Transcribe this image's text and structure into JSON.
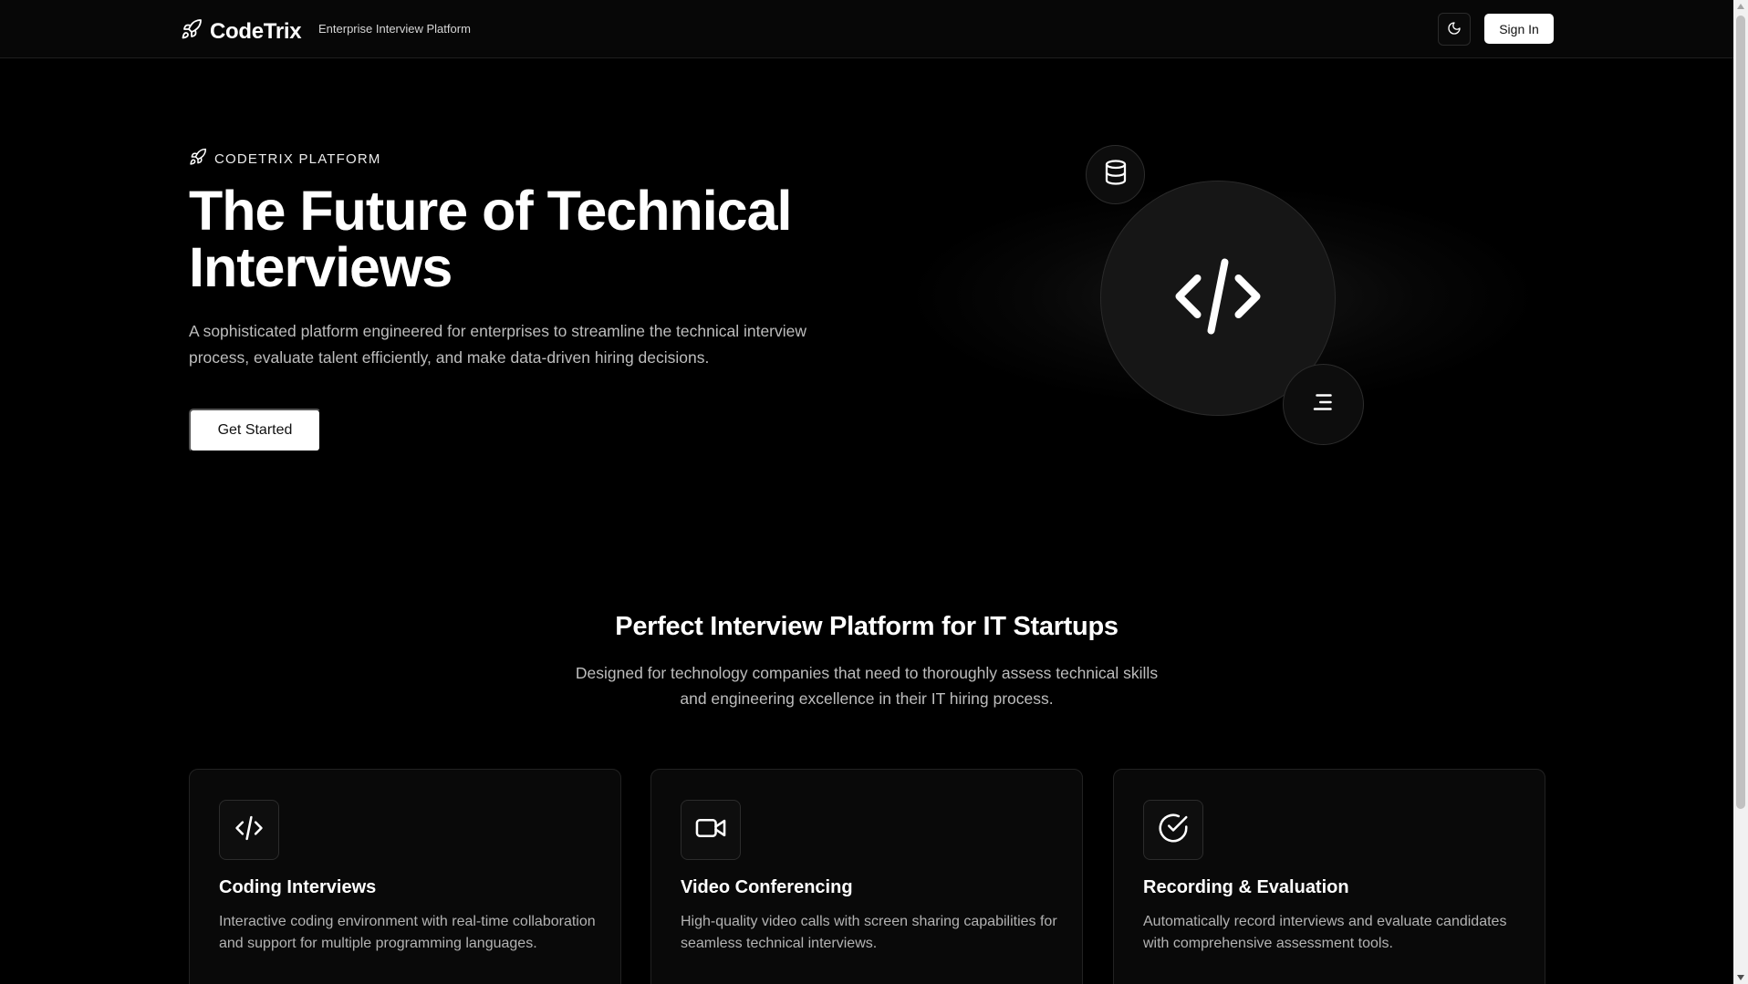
{
  "header": {
    "brand_name": "CodeTrix",
    "tagline": "Enterprise Interview Platform",
    "theme_toggle_icon": "moon-icon",
    "signin_label": "Sign In"
  },
  "hero": {
    "eyebrow": "CODETRIX PLATFORM",
    "title_line1": "The Future of Technical",
    "title_line2": "Interviews",
    "description_line1": "A sophisticated platform engineered for enterprises to streamline the technical interview",
    "description_line2": "process, evaluate talent efficiently, and make data-driven hiring decisions.",
    "cta_label": "Get Started",
    "illustration_icons": [
      "code-icon",
      "database-icon",
      "menu-icon"
    ]
  },
  "section": {
    "title": "Perfect Interview Platform for IT Startups",
    "description_line1": "Designed for technology companies that need to thoroughly assess technical skills",
    "description_line2": "and engineering excellence in their IT hiring process."
  },
  "features": [
    {
      "icon": "code-icon",
      "title": "Coding Interviews",
      "description": "Interactive coding environment with real-time collaboration and support for multiple programming languages."
    },
    {
      "icon": "video-icon",
      "title": "Video Conferencing",
      "description": "High-quality video calls with screen sharing capabilities for seamless technical interviews."
    },
    {
      "icon": "check-circle-icon",
      "title": "Recording & Evaluation",
      "description": "Automatically record interviews and evaluate candidates with comprehensive assessment tools."
    }
  ],
  "colors": {
    "background": "#000000",
    "text": "#ffffff",
    "muted_text": "#bdbdbd",
    "card_background": "#090909",
    "border": "#222222"
  }
}
